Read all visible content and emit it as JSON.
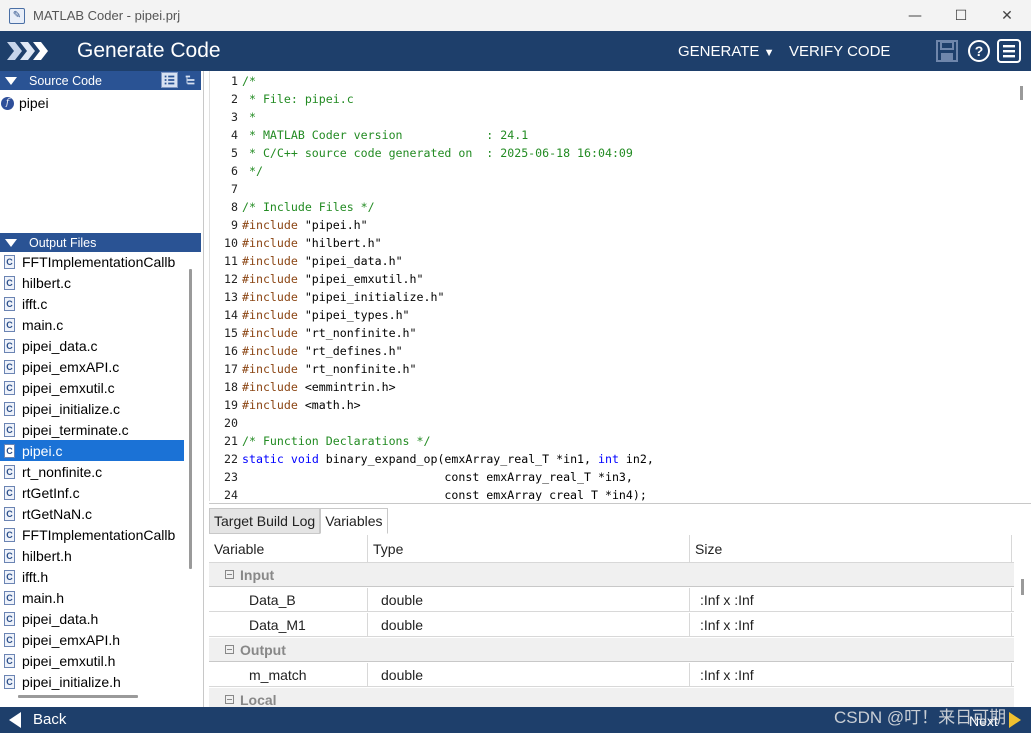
{
  "window": {
    "title": "MATLAB Coder - pipei.prj",
    "minimize": "—",
    "maximize": "☐",
    "close": "✕"
  },
  "header": {
    "title": "Generate Code",
    "generate_label": "GENERATE",
    "verify_label": "VERIFY CODE"
  },
  "source_code": {
    "section_label": "Source Code",
    "items": [
      {
        "label": "pipei"
      }
    ]
  },
  "output_files": {
    "section_label": "Output Files",
    "selected_index": 9,
    "items": [
      "FFTImplementationCallb",
      "hilbert.c",
      "ifft.c",
      "main.c",
      "pipei_data.c",
      "pipei_emxAPI.c",
      "pipei_emxutil.c",
      "pipei_initialize.c",
      "pipei_terminate.c",
      "pipei.c",
      "rt_nonfinite.c",
      "rtGetInf.c",
      "rtGetNaN.c",
      "FFTImplementationCallb",
      "hilbert.h",
      "ifft.h",
      "main.h",
      "pipei_data.h",
      "pipei_emxAPI.h",
      "pipei_emxutil.h",
      "pipei_initialize.h"
    ]
  },
  "code_lines": [
    {
      "n": "1",
      "parts": [
        {
          "t": "/*",
          "c": "cm"
        }
      ]
    },
    {
      "n": "2",
      "parts": [
        {
          "t": " * File: pipei.c",
          "c": "cm"
        }
      ]
    },
    {
      "n": "3",
      "parts": [
        {
          "t": " *",
          "c": "cm"
        }
      ]
    },
    {
      "n": "4",
      "parts": [
        {
          "t": " * MATLAB Coder version            : 24.1",
          "c": "cm"
        }
      ]
    },
    {
      "n": "5",
      "parts": [
        {
          "t": " * C/C++ source code generated on  : 2025-06-18 16:04:09",
          "c": "cm"
        }
      ]
    },
    {
      "n": "6",
      "parts": [
        {
          "t": " */",
          "c": "cm"
        }
      ]
    },
    {
      "n": "7",
      "parts": []
    },
    {
      "n": "8",
      "parts": [
        {
          "t": "/* Include Files */",
          "c": "cm"
        }
      ]
    },
    {
      "n": "9",
      "parts": [
        {
          "t": "#include",
          "c": "pp"
        },
        {
          "t": " \"pipei.h\"",
          "c": "tx"
        }
      ]
    },
    {
      "n": "10",
      "parts": [
        {
          "t": "#include",
          "c": "pp"
        },
        {
          "t": " \"hilbert.h\"",
          "c": "tx"
        }
      ]
    },
    {
      "n": "11",
      "parts": [
        {
          "t": "#include",
          "c": "pp"
        },
        {
          "t": " \"pipei_data.h\"",
          "c": "tx"
        }
      ]
    },
    {
      "n": "12",
      "parts": [
        {
          "t": "#include",
          "c": "pp"
        },
        {
          "t": " \"pipei_emxutil.h\"",
          "c": "tx"
        }
      ]
    },
    {
      "n": "13",
      "parts": [
        {
          "t": "#include",
          "c": "pp"
        },
        {
          "t": " \"pipei_initialize.h\"",
          "c": "tx"
        }
      ]
    },
    {
      "n": "14",
      "parts": [
        {
          "t": "#include",
          "c": "pp"
        },
        {
          "t": " \"pipei_types.h\"",
          "c": "tx"
        }
      ]
    },
    {
      "n": "15",
      "parts": [
        {
          "t": "#include",
          "c": "pp"
        },
        {
          "t": " \"rt_nonfinite.h\"",
          "c": "tx"
        }
      ]
    },
    {
      "n": "16",
      "parts": [
        {
          "t": "#include",
          "c": "pp"
        },
        {
          "t": " \"rt_defines.h\"",
          "c": "tx"
        }
      ]
    },
    {
      "n": "17",
      "parts": [
        {
          "t": "#include",
          "c": "pp"
        },
        {
          "t": " \"rt_nonfinite.h\"",
          "c": "tx"
        }
      ]
    },
    {
      "n": "18",
      "parts": [
        {
          "t": "#include",
          "c": "pp"
        },
        {
          "t": " <emmintrin.h>",
          "c": "tx"
        }
      ]
    },
    {
      "n": "19",
      "parts": [
        {
          "t": "#include",
          "c": "pp"
        },
        {
          "t": " <math.h>",
          "c": "tx"
        }
      ]
    },
    {
      "n": "20",
      "parts": []
    },
    {
      "n": "21",
      "parts": [
        {
          "t": "/* Function Declarations */",
          "c": "cm"
        }
      ]
    },
    {
      "n": "22",
      "parts": [
        {
          "t": "static",
          "c": "kw"
        },
        {
          "t": " ",
          "c": "tx"
        },
        {
          "t": "void",
          "c": "kw"
        },
        {
          "t": " binary_expand_op(emxArray_real_T *in1, ",
          "c": "tx"
        },
        {
          "t": "int",
          "c": "kw"
        },
        {
          "t": " in2,",
          "c": "tx"
        }
      ]
    },
    {
      "n": "23",
      "parts": [
        {
          "t": "                             const emxArray_real_T *in3,",
          "c": "tx"
        }
      ]
    },
    {
      "n": "24",
      "parts": [
        {
          "t": "                             const emxArray_creal_T *in4);",
          "c": "tx"
        }
      ]
    }
  ],
  "bottom_tabs": [
    {
      "label": "Target Build Log"
    },
    {
      "label": "Variables"
    }
  ],
  "variables": {
    "columns": [
      "Variable",
      "Type",
      "Size"
    ],
    "groups": [
      {
        "label": "Input",
        "rows": [
          {
            "name": "Data_B",
            "type": "double",
            "size": ":Inf x :Inf"
          },
          {
            "name": "Data_M1",
            "type": "double",
            "size": ":Inf x :Inf"
          }
        ]
      },
      {
        "label": "Output",
        "rows": [
          {
            "name": "m_match",
            "type": "double",
            "size": ":Inf x :Inf"
          }
        ]
      },
      {
        "label": "Local",
        "rows": []
      }
    ]
  },
  "footer": {
    "back_label": "Back",
    "next_label": "Next"
  },
  "watermark": "CSDN @叮！来日可期",
  "colors": {
    "header_bg": "#1e3f6b",
    "section_head": "#2a5394",
    "selection": "#1b72d6",
    "comment": "#228b22",
    "preprocessor": "#8b4513",
    "keyword": "#0000ff"
  }
}
